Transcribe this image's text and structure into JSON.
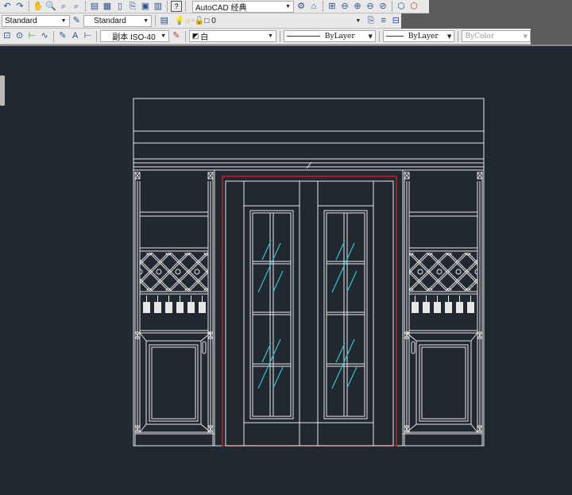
{
  "toolbar1": {
    "workspace": "AutoCAD 经典",
    "icons": [
      "undo-icon",
      "redo-icon",
      "pan-icon",
      "zoom-realtime-icon",
      "zoom-window-icon",
      "zoom-previous-icon",
      "properties-icon",
      "design-center-icon",
      "tool-palettes-icon",
      "sheet-set-icon",
      "markup-icon",
      "calculator-icon",
      "help-icon",
      "settings-icon",
      "workspace-save-icon",
      "viewport-icon",
      "ucs-icon",
      "ucs-add-icon",
      "ucs-remove-icon",
      "orbit-icon",
      "view-icon",
      "view2-icon"
    ]
  },
  "toolbar2": {
    "text_style": "Standard",
    "table_style": "Standard",
    "layer": "0"
  },
  "toolbar3": {
    "dim_style": "副本 ISO-40",
    "color": "白",
    "linetype": "ByLayer",
    "lineweight": "ByLayer",
    "plot_style": "ByColor"
  },
  "colors": {
    "canvas": "#212830",
    "lines": "#e6e6e6",
    "red": "#b3262a",
    "cyan": "#2ec6d0"
  }
}
